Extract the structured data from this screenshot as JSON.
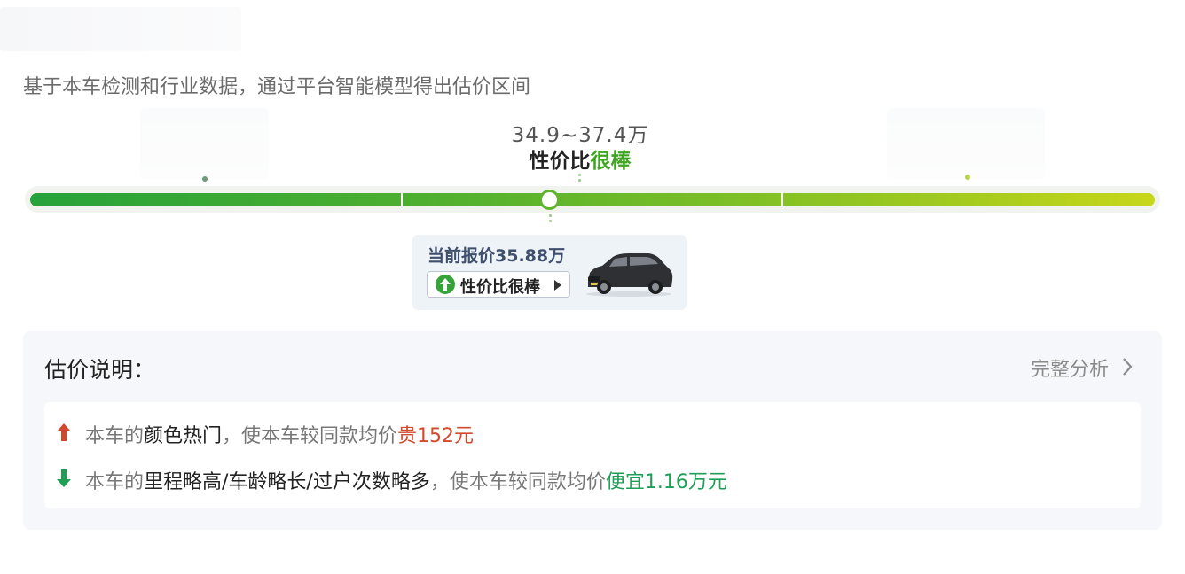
{
  "subtitle": "基于本车检测和行业数据，通过平台智能模型得出估价区间",
  "estimate": {
    "range": "34.9~37.4万",
    "rating_prefix": "性价比",
    "rating_level": "很棒"
  },
  "price_bar": {
    "segments": 3,
    "current_position": 0.46
  },
  "tooltip": {
    "title": "当前报价35.88万",
    "badge_label": "性价比很棒",
    "badge_icon": "arrow-up-circle-icon",
    "car_image": "dark-suv-thumbnail"
  },
  "explanation": {
    "title": "估价说明：",
    "full_analysis_link": "完整分析",
    "items": [
      {
        "icon": "arrow-up-icon",
        "prefix": "本车的",
        "factor": "颜色热门",
        "middle": "，使本车较同款均价",
        "effect": "贵152元"
      },
      {
        "icon": "arrow-down-icon",
        "prefix": "本车的",
        "factor": "里程略高/车龄略长/过户次数略多",
        "middle": "，使本车较同款均价",
        "effect": "便宜1.16万元"
      }
    ]
  },
  "colors": {
    "good": "#3ea520",
    "price_up": "#d14a2e",
    "price_down": "#1f9e55",
    "bar_start": "#27a23a",
    "bar_end": "#c7d71b"
  }
}
